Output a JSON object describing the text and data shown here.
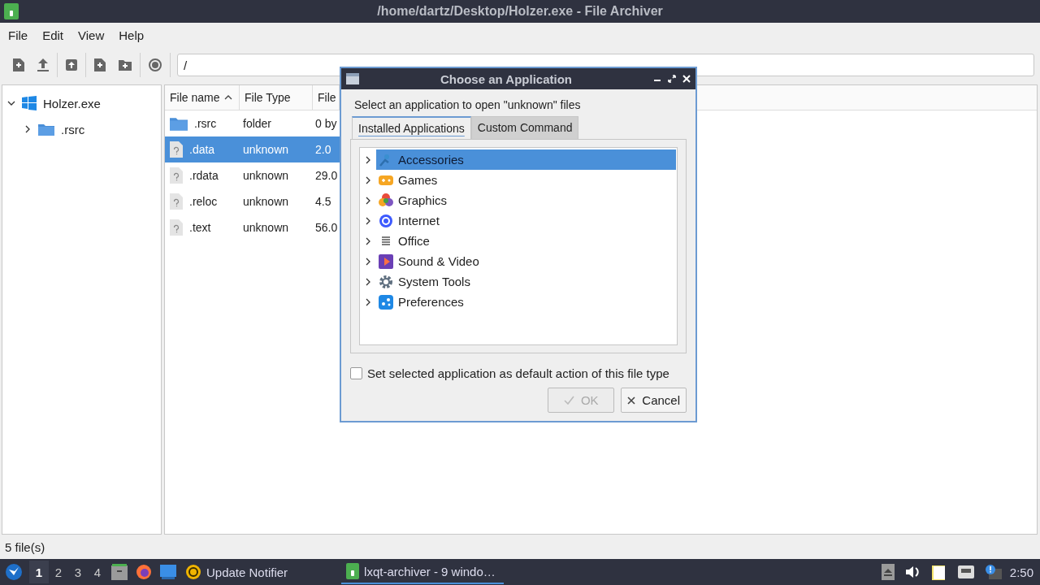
{
  "window": {
    "title": "/home/dartz/Desktop/Holzer.exe - File Archiver"
  },
  "menu": [
    {
      "label": "File"
    },
    {
      "label": "Edit"
    },
    {
      "label": "View"
    },
    {
      "label": "Help"
    }
  ],
  "toolbar": {
    "path": "/"
  },
  "tree": [
    {
      "label": "Holzer.exe",
      "expanded": true,
      "children": [
        {
          "label": ".rsrc",
          "expanded": false
        }
      ]
    }
  ],
  "file_list": {
    "columns": [
      {
        "label": "File name",
        "sorted": true
      },
      {
        "label": "File Type",
        "sorted": false
      },
      {
        "label": "File"
      }
    ],
    "rows": [
      {
        "kind": "folder",
        "name": ".rsrc",
        "type": "folder",
        "column_3": "0 by",
        "selected": false
      },
      {
        "kind": "file",
        "name": ".data",
        "type": "unknown",
        "column_3": "2.0",
        "selected": true
      },
      {
        "kind": "file",
        "name": ".rdata",
        "type": "unknown",
        "column_3": "29.0",
        "selected": false
      },
      {
        "kind": "file",
        "name": ".reloc",
        "type": "unknown",
        "column_3": "4.5",
        "selected": false
      },
      {
        "kind": "file",
        "name": ".text",
        "type": "unknown",
        "column_3": "56.0",
        "selected": false
      }
    ]
  },
  "status_bar": "5 file(s)",
  "dialog": {
    "title": "Choose an Application",
    "prompt": "Select an application to open \"unknown\" files",
    "tabs": [
      {
        "label": "Installed Applications",
        "selected": true
      },
      {
        "label": "Custom Command",
        "selected": false
      }
    ],
    "categories": [
      {
        "label": "Accessories",
        "selected": true
      },
      {
        "label": "Games",
        "selected": false
      },
      {
        "label": "Graphics",
        "selected": false
      },
      {
        "label": "Internet",
        "selected": false
      },
      {
        "label": "Office",
        "selected": false
      },
      {
        "label": "Sound & Video",
        "selected": false
      },
      {
        "label": "System Tools",
        "selected": false
      },
      {
        "label": "Preferences",
        "selected": false
      }
    ],
    "default_checkbox": {
      "label": "Set selected application as default action of this file type",
      "checked": false
    },
    "buttons": [
      {
        "kind": "ok",
        "label": "OK",
        "disabled": true
      },
      {
        "kind": "cancel",
        "label": "Cancel",
        "disabled": false
      }
    ]
  },
  "taskbar": {
    "workspaces": [
      {
        "label": "1",
        "selected": true
      },
      {
        "label": "2",
        "selected": false
      },
      {
        "label": "3",
        "selected": false
      },
      {
        "label": "4",
        "selected": false
      }
    ],
    "tasks": [
      {
        "kind": "notifier",
        "label": "Update Notifier",
        "selected": false
      },
      {
        "kind": "archiver",
        "label": "lxqt-archiver - 9 windo…",
        "selected": true
      }
    ],
    "clock": "2:50"
  }
}
